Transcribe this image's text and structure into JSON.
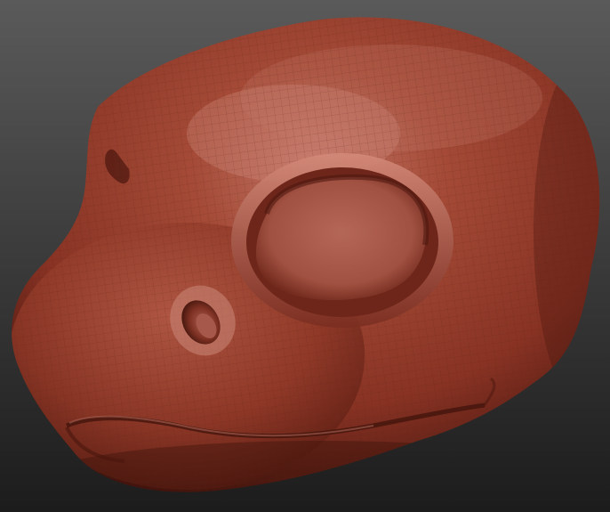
{
  "viewport": {
    "background_top": "#5a5a5a",
    "background_bottom": "#1c1c1c"
  },
  "model": {
    "material_base": "#9a3f2e",
    "material_highlight": "#c77a6a",
    "material_shadow": "#4a170f",
    "wireframe_color": "#5e2217",
    "parts": [
      "head-sculpt",
      "eye-socket",
      "nostril",
      "mouth-line"
    ]
  }
}
